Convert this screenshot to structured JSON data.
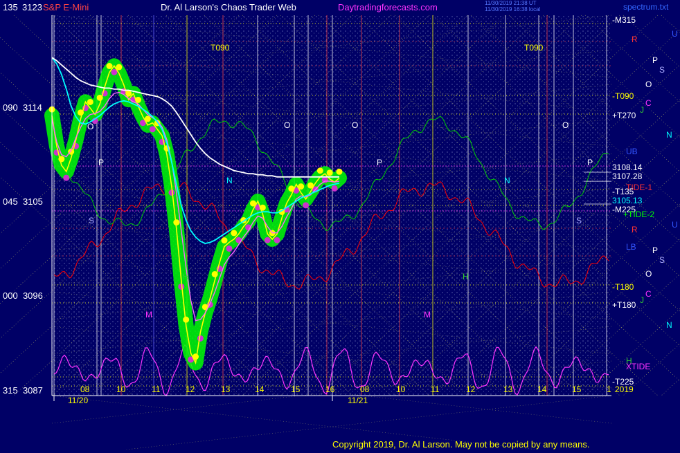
{
  "header": {
    "left_title": "S&P E-Mini",
    "center_title": "Dr. Al Larson's Chaos Trader Web",
    "site": "Daytradingforecasts.com",
    "timestamp_1": "11/30/2019 21:38 UT",
    "timestamp_2": "11/30/2019 16:38 local",
    "right_tag": "spectrum.txt"
  },
  "y_axis_labels": [
    {
      "code": "135",
      "price": "3123"
    },
    {
      "code": "090",
      "price": "3114"
    },
    {
      "code": "045",
      "price": "3105"
    },
    {
      "code": "000",
      "price": "3096"
    },
    {
      "code": "315",
      "price": "3087"
    }
  ],
  "x_axis": {
    "hour_labels": [
      "08",
      "10",
      "11",
      "12",
      "13",
      "14",
      "15",
      "16",
      "08",
      "10",
      "11",
      "12",
      "13",
      "14",
      "15",
      "1"
    ],
    "date_labels": [
      "11/20",
      "11/21"
    ]
  },
  "right_labels": {
    "m315": "-M315",
    "t090": "-T090",
    "t270": "+T270",
    "p3108": "3108.14",
    "p3107": "3107.28",
    "t135": "-T135",
    "p3105": "3105.13",
    "m225": "-M225",
    "tide1": "TIDE-1",
    "tide2": "+TIDE-2",
    "t180a": "-T180",
    "t180b": "+T180",
    "xtide": "XTIDE",
    "t225": "-T225",
    "p2019": "2019",
    "r1": "R",
    "u1": "U",
    "p1": "P",
    "s1": "S",
    "o1": "O",
    "c1": "C",
    "j1": "J",
    "n1": "N",
    "ub": "UB",
    "lb": "LB",
    "r2": "R",
    "u2": "U",
    "p2": "P",
    "s2": "S",
    "o2": "O",
    "c2": "C",
    "j2": "J",
    "n2": "N",
    "h2": "H"
  },
  "chart_letters": {
    "t090_a": "T090",
    "t090_b": "T090",
    "o_a": "O",
    "o_b": "O",
    "o_c": "O",
    "o_d": "O",
    "p_a": "P",
    "p_b": "P",
    "p_c": "P",
    "s_a": "S",
    "s_b": "S",
    "m_a": "M",
    "m_b": "M",
    "h_a": "H",
    "h_b": "H",
    "n_a": "N",
    "n_b": "N"
  },
  "copyright": "Copyright 2019, Dr. Al Larson. May not be copied by any means.",
  "colors": {
    "background": "#000066",
    "price": "#ffff00",
    "moving_avg": "#ff66ff",
    "ema_fast": "#00ffff",
    "ema_slow": "#ffffff",
    "energy_band": "#00ff00",
    "tide1": "#ff0000",
    "tide2": "#00cc00",
    "xtide": "#ff33ff"
  },
  "chart_data": {
    "type": "line",
    "title": "S&P E-Mini",
    "y_axis": {
      "range": [
        3087,
        3123
      ],
      "ticks": [
        3087,
        3096,
        3105,
        3114,
        3123
      ]
    },
    "x_axis": {
      "sessions": [
        "11/20",
        "11/21"
      ],
      "hours_11_20": [
        8,
        10,
        11,
        12,
        13,
        14,
        15,
        16
      ],
      "hours_11_21": [
        8,
        10,
        11,
        12,
        13,
        14,
        15,
        1
      ]
    },
    "price_levels": [
      3108.14,
      3107.28,
      3105.13
    ],
    "series": [
      {
        "x": [
          0,
          1,
          2,
          3,
          4,
          5,
          6,
          7,
          8,
          9,
          10,
          11,
          12,
          13,
          14,
          15,
          16,
          17,
          18,
          19,
          20,
          21,
          22,
          23,
          24,
          25,
          26,
          27,
          28,
          29,
          30,
          31,
          32,
          33,
          34,
          35,
          36,
          37,
          38,
          39,
          40,
          41,
          42,
          43,
          44,
          45,
          46,
          47,
          48,
          49,
          50,
          51,
          52,
          53,
          54,
          55,
          56,
          57,
          58,
          59,
          60
        ],
        "values": [
          3113.5,
          3110.6,
          3108.8,
          3108.2,
          3109.5,
          3111.2,
          3113.2,
          3114.8,
          3114.2,
          3113.6,
          3114.6,
          3116.2,
          3117.6,
          3118.2,
          3117.5,
          3116.4,
          3115.0,
          3115.6,
          3114.4,
          3113.4,
          3112.6,
          3112.8,
          3112.2,
          3111.6,
          3109.8,
          3106.8,
          3102.8,
          3097.9,
          3093.6,
          3091.0,
          3090.1,
          3093.0,
          3094.8,
          3096.2,
          3097.9,
          3099.6,
          3101.1,
          3101.5,
          3101.8,
          3102.3,
          3103.0,
          3103.5,
          3104.6,
          3105.4,
          3104.2,
          3102.3,
          3101.8,
          3102.3,
          3103.8,
          3105.2,
          3106.0,
          3107.0,
          3106.2,
          3105.6,
          3106.3,
          3107.1,
          3107.7,
          3108.0,
          3107.5,
          3107.2,
          3107.6
        ]
      },
      {
        "values": [
          3113.2,
          3111.0,
          3109.8,
          3109.6,
          3110.2,
          3111.4,
          3112.4,
          3113.2,
          3113.6,
          3113.7,
          3113.9,
          3114.4,
          3115.1,
          3115.6,
          3115.7,
          3115.5,
          3115.1,
          3114.8,
          3114.6,
          3114.1,
          3113.6,
          3113.3,
          3113.0,
          3112.4,
          3111.2,
          3109.2,
          3106.2,
          3102.6,
          3099.1,
          3096.0,
          3094.1,
          3094.2,
          3094.8,
          3095.7,
          3096.8,
          3098.1,
          3099.4,
          3100.1,
          3100.6,
          3101.3,
          3102.0,
          3102.6,
          3103.4,
          3104.0,
          3103.8,
          3103.0,
          3102.4,
          3102.4,
          3103.0,
          3103.9,
          3104.7,
          3105.6,
          3105.9,
          3105.8,
          3106.0,
          3106.5,
          3107.0,
          3107.3,
          3107.3,
          3107.2,
          3107.3
        ]
      },
      {
        "values": [
          3119.0,
          3118.4,
          3117.4,
          3116.0,
          3114.4,
          3113.4,
          3112.8,
          3112.7,
          3112.9,
          3113.2,
          3113.5,
          3113.9,
          3114.3,
          3114.6,
          3114.8,
          3114.9,
          3114.8,
          3114.6,
          3114.4,
          3114.1,
          3113.8,
          3113.4,
          3112.9,
          3112.2,
          3110.9,
          3109.1,
          3107.0,
          3105.0,
          3103.6,
          3102.6,
          3102.0,
          3101.6,
          3101.4,
          3101.5,
          3101.7,
          3102.0,
          3102.3,
          3102.6,
          3102.9,
          3103.2,
          3103.5,
          3103.8,
          3104.1,
          3104.3,
          3104.4,
          3104.4,
          3104.3,
          3104.3,
          3104.5,
          3104.8,
          3105.1,
          3105.4,
          3105.7,
          3105.9,
          3106.1,
          3106.3,
          3106.5,
          3106.7,
          3106.9,
          3107.0,
          3107.1
        ]
      },
      {
        "values": [
          3119.0,
          3118.7,
          3118.3,
          3117.9,
          3117.5,
          3117.1,
          3116.8,
          3116.6,
          3116.4,
          3116.3,
          3116.2,
          3116.1,
          3116.1,
          3116.0,
          3116.0,
          3115.9,
          3115.9,
          3115.8,
          3115.7,
          3115.6,
          3115.5,
          3115.4,
          3115.3,
          3115.1,
          3114.8,
          3114.4,
          3113.8,
          3113.1,
          3112.4,
          3111.7,
          3111.0,
          3110.4,
          3109.9,
          3109.5,
          3109.2,
          3108.9,
          3108.7,
          3108.5,
          3108.3,
          3108.2,
          3108.1,
          3108.0,
          3108.0,
          3107.9,
          3107.9,
          3107.8,
          3107.8,
          3107.7,
          3107.7,
          3107.7,
          3107.7,
          3107.7,
          3107.7,
          3107.7,
          3107.7,
          3107.7,
          3107.7,
          3107.7,
          3107.7,
          3107.7,
          3107.7
        ]
      }
    ]
  }
}
